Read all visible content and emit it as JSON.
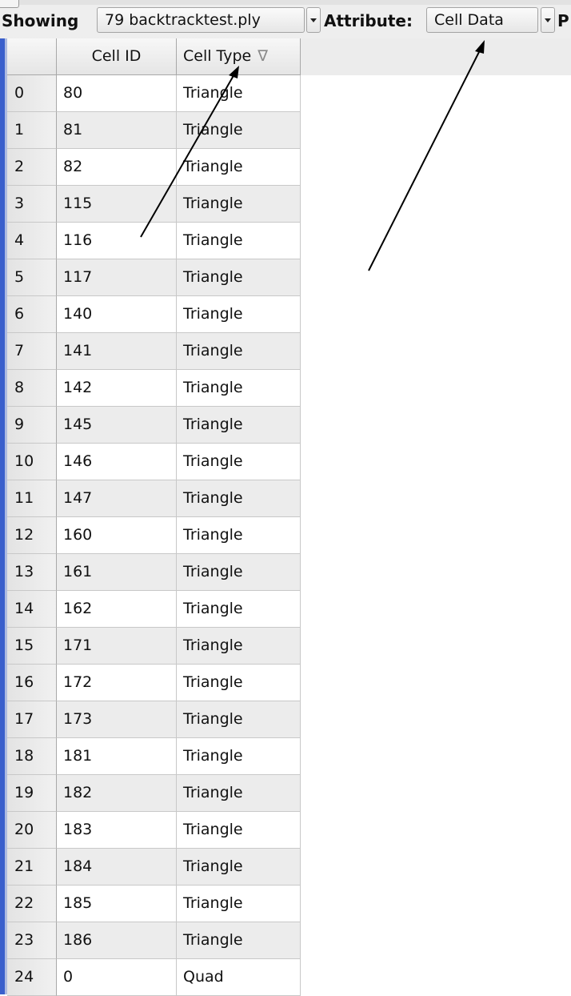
{
  "toolbar": {
    "showing_label": "Showing",
    "source_value": "79 backtracktest.ply",
    "attribute_label": "Attribute:",
    "attribute_value": "Cell Data",
    "trailing_label": "P"
  },
  "table": {
    "columns": [
      "",
      "Cell ID",
      "Cell Type"
    ],
    "sort_indicator": "∇",
    "rows": [
      {
        "index": "0",
        "cell_id": "80",
        "cell_type": "Triangle"
      },
      {
        "index": "1",
        "cell_id": "81",
        "cell_type": "Triangle"
      },
      {
        "index": "2",
        "cell_id": "82",
        "cell_type": "Triangle"
      },
      {
        "index": "3",
        "cell_id": "115",
        "cell_type": "Triangle"
      },
      {
        "index": "4",
        "cell_id": "116",
        "cell_type": "Triangle"
      },
      {
        "index": "5",
        "cell_id": "117",
        "cell_type": "Triangle"
      },
      {
        "index": "6",
        "cell_id": "140",
        "cell_type": "Triangle"
      },
      {
        "index": "7",
        "cell_id": "141",
        "cell_type": "Triangle"
      },
      {
        "index": "8",
        "cell_id": "142",
        "cell_type": "Triangle"
      },
      {
        "index": "9",
        "cell_id": "145",
        "cell_type": "Triangle"
      },
      {
        "index": "10",
        "cell_id": "146",
        "cell_type": "Triangle"
      },
      {
        "index": "11",
        "cell_id": "147",
        "cell_type": "Triangle"
      },
      {
        "index": "12",
        "cell_id": "160",
        "cell_type": "Triangle"
      },
      {
        "index": "13",
        "cell_id": "161",
        "cell_type": "Triangle"
      },
      {
        "index": "14",
        "cell_id": "162",
        "cell_type": "Triangle"
      },
      {
        "index": "15",
        "cell_id": "171",
        "cell_type": "Triangle"
      },
      {
        "index": "16",
        "cell_id": "172",
        "cell_type": "Triangle"
      },
      {
        "index": "17",
        "cell_id": "173",
        "cell_type": "Triangle"
      },
      {
        "index": "18",
        "cell_id": "181",
        "cell_type": "Triangle"
      },
      {
        "index": "19",
        "cell_id": "182",
        "cell_type": "Triangle"
      },
      {
        "index": "20",
        "cell_id": "183",
        "cell_type": "Triangle"
      },
      {
        "index": "21",
        "cell_id": "184",
        "cell_type": "Triangle"
      },
      {
        "index": "22",
        "cell_id": "185",
        "cell_type": "Triangle"
      },
      {
        "index": "23",
        "cell_id": "186",
        "cell_type": "Triangle"
      },
      {
        "index": "24",
        "cell_id": "0",
        "cell_type": "Quad"
      }
    ]
  },
  "icons": {
    "dropdown": "chevron-down-icon",
    "sort": "sort-descending-icon",
    "annotation": "arrow-annotation-icon"
  },
  "colors": {
    "frame_accent": "#3a5fcc",
    "row_alt": "#ececec",
    "header_bg": "#e5e5e5"
  }
}
